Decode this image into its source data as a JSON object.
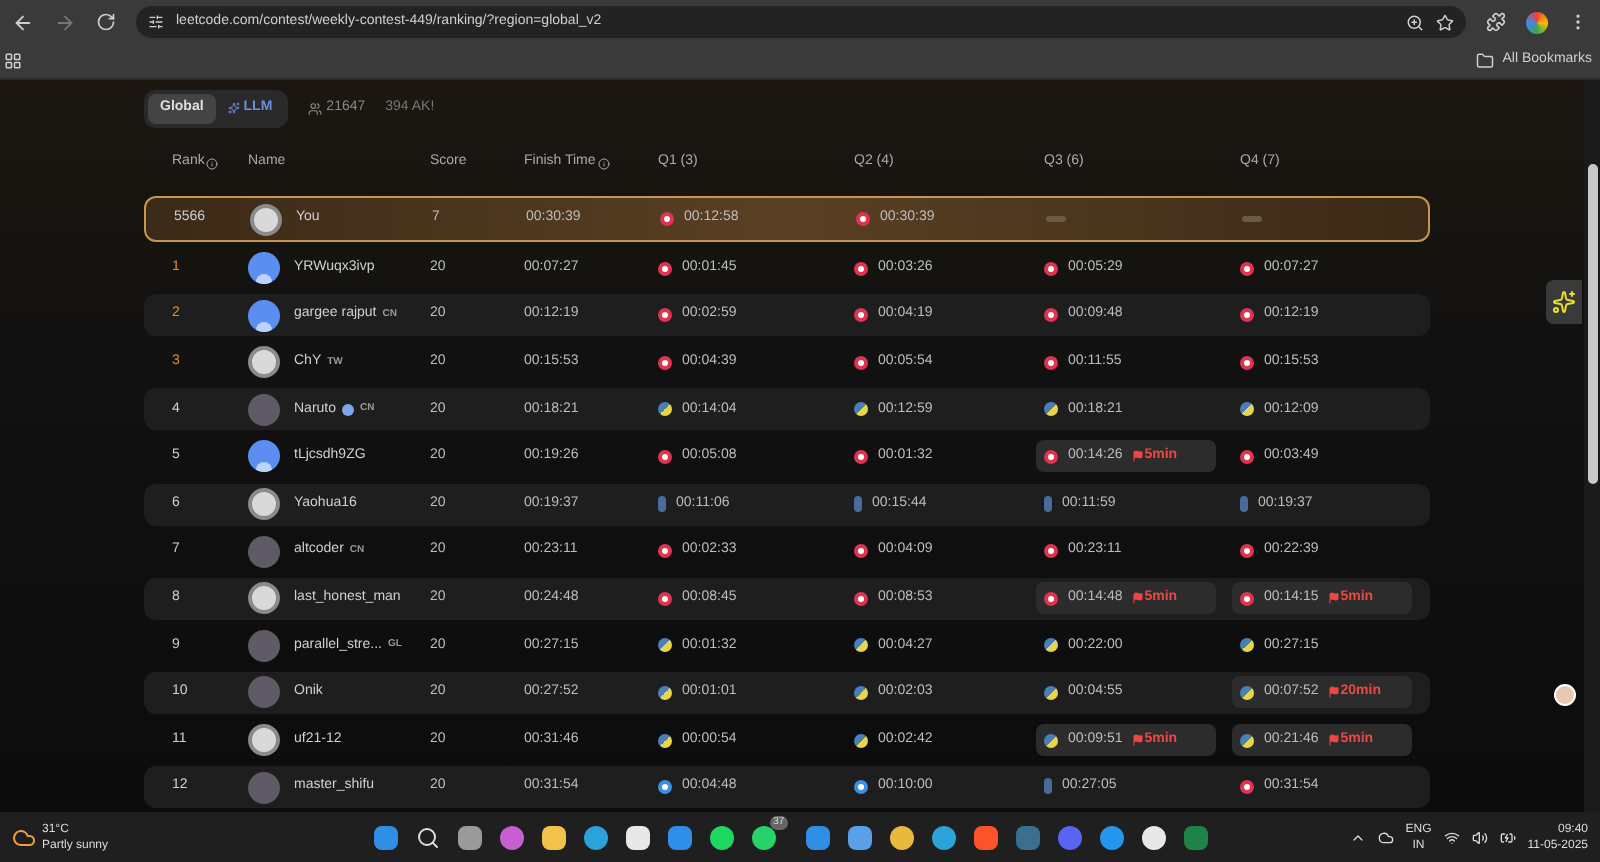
{
  "browser": {
    "url": "leetcode.com/contest/weekly-contest-449/ranking/?region=global_v2",
    "bookmarks_label": "All Bookmarks"
  },
  "toolbar": {
    "tabs": [
      {
        "label": "Global",
        "selected": true
      },
      {
        "label": "LLM",
        "selected": false
      }
    ],
    "participants": "21647",
    "ak": "394 AK!"
  },
  "table": {
    "columns": [
      "Rank",
      "Name",
      "Score",
      "Finish Time",
      "Q1 (3)",
      "Q2 (4)",
      "Q3 (6)",
      "Q4 (7)"
    ],
    "my_row": {
      "rank": "5566",
      "name": "You",
      "avatar": {
        "kind": "blank"
      },
      "score": "7",
      "finish": "00:30:39",
      "cells": [
        {
          "kind": "cpp",
          "time": "00:12:58"
        },
        {
          "kind": "cpp",
          "time": "00:30:39"
        },
        {
          "kind": "none"
        },
        {
          "kind": "none"
        }
      ]
    },
    "rows": [
      {
        "rank": "1",
        "medal": true,
        "name": "YRWuqx3ivp",
        "avatar": {
          "kind": "default"
        },
        "score": "20",
        "finish": "00:07:27",
        "cells": [
          {
            "kind": "cpp",
            "time": "00:01:45"
          },
          {
            "kind": "cpp",
            "time": "00:03:26"
          },
          {
            "kind": "cpp",
            "time": "00:05:29"
          },
          {
            "kind": "cpp",
            "time": "00:07:27"
          }
        ]
      },
      {
        "rank": "2",
        "medal": true,
        "name": "gargee rajput",
        "tag": "CN",
        "avatar": {
          "kind": "default"
        },
        "score": "20",
        "finish": "00:12:19",
        "cells": [
          {
            "kind": "cpp",
            "time": "00:02:59"
          },
          {
            "kind": "cpp",
            "time": "00:04:19"
          },
          {
            "kind": "cpp",
            "time": "00:09:48"
          },
          {
            "kind": "cpp",
            "time": "00:12:19"
          }
        ]
      },
      {
        "rank": "3",
        "medal": true,
        "name": "ChY",
        "tag": "TW",
        "avatar": {
          "kind": "blank"
        },
        "score": "20",
        "finish": "00:15:53",
        "cells": [
          {
            "kind": "cpp",
            "time": "00:04:39"
          },
          {
            "kind": "cpp",
            "time": "00:05:54"
          },
          {
            "kind": "cpp",
            "time": "00:11:55"
          },
          {
            "kind": "cpp",
            "time": "00:15:53"
          }
        ]
      },
      {
        "rank": "4",
        "medal": false,
        "name": "Naruto",
        "badge": true,
        "tag": "CN",
        "avatar": {
          "kind": "image"
        },
        "score": "20",
        "finish": "00:18:21",
        "cells": [
          {
            "kind": "python",
            "time": "00:14:04"
          },
          {
            "kind": "python",
            "time": "00:12:59"
          },
          {
            "kind": "python",
            "time": "00:18:21"
          },
          {
            "kind": "python",
            "time": "00:12:09"
          }
        ]
      },
      {
        "rank": "5",
        "medal": false,
        "name": "tLjcsdh9ZG",
        "avatar": {
          "kind": "default"
        },
        "score": "20",
        "finish": "00:19:26",
        "cells": [
          {
            "kind": "cpp",
            "time": "00:05:08"
          },
          {
            "kind": "cpp",
            "time": "00:01:32"
          },
          {
            "kind": "cpp",
            "time": "00:14:26",
            "penalty": "5min"
          },
          {
            "kind": "cpp",
            "time": "00:03:49"
          }
        ]
      },
      {
        "rank": "6",
        "medal": false,
        "name": "Yaohua16",
        "avatar": {
          "kind": "blank"
        },
        "score": "20",
        "finish": "00:19:37",
        "cells": [
          {
            "kind": "java",
            "time": "00:11:06"
          },
          {
            "kind": "java",
            "time": "00:15:44"
          },
          {
            "kind": "java",
            "time": "00:11:59"
          },
          {
            "kind": "java",
            "time": "00:19:37"
          }
        ]
      },
      {
        "rank": "7",
        "medal": false,
        "name": "altcoder",
        "tag": "CN",
        "avatar": {
          "kind": "image"
        },
        "score": "20",
        "finish": "00:23:11",
        "cells": [
          {
            "kind": "cpp",
            "time": "00:02:33"
          },
          {
            "kind": "cpp",
            "time": "00:04:09"
          },
          {
            "kind": "cpp",
            "time": "00:23:11"
          },
          {
            "kind": "cpp",
            "time": "00:22:39"
          }
        ]
      },
      {
        "rank": "8",
        "medal": false,
        "name": "last_honest_man",
        "avatar": {
          "kind": "blank"
        },
        "score": "20",
        "finish": "00:24:48",
        "cells": [
          {
            "kind": "cpp",
            "time": "00:08:45"
          },
          {
            "kind": "cpp",
            "time": "00:08:53"
          },
          {
            "kind": "cpp",
            "time": "00:14:48",
            "penalty": "5min"
          },
          {
            "kind": "cpp",
            "time": "00:14:15",
            "penalty": "5min"
          }
        ]
      },
      {
        "rank": "9",
        "medal": false,
        "name": "parallel_stre...",
        "tag": "GL",
        "avatar": {
          "kind": "image"
        },
        "score": "20",
        "finish": "00:27:15",
        "cells": [
          {
            "kind": "python",
            "time": "00:01:32"
          },
          {
            "kind": "python",
            "time": "00:04:27"
          },
          {
            "kind": "python",
            "time": "00:22:00"
          },
          {
            "kind": "python",
            "time": "00:27:15"
          }
        ]
      },
      {
        "rank": "10",
        "medal": false,
        "name": "Onik",
        "avatar": {
          "kind": "image"
        },
        "score": "20",
        "finish": "00:27:52",
        "cells": [
          {
            "kind": "python",
            "time": "00:01:01"
          },
          {
            "kind": "python",
            "time": "00:02:03"
          },
          {
            "kind": "python",
            "time": "00:04:55"
          },
          {
            "kind": "python",
            "time": "00:07:52",
            "penalty": "20min"
          }
        ]
      },
      {
        "rank": "11",
        "medal": false,
        "name": "uf21-12",
        "avatar": {
          "kind": "blank"
        },
        "score": "20",
        "finish": "00:31:46",
        "cells": [
          {
            "kind": "python",
            "time": "00:00:54"
          },
          {
            "kind": "python",
            "time": "00:02:42"
          },
          {
            "kind": "python",
            "time": "00:09:51",
            "penalty": "5min"
          },
          {
            "kind": "python",
            "time": "00:21:46",
            "penalty": "5min"
          }
        ]
      },
      {
        "rank": "12",
        "medal": false,
        "name": "master_shifu",
        "avatar": {
          "kind": "image"
        },
        "score": "20",
        "finish": "00:31:54",
        "cells": [
          {
            "kind": "c",
            "time": "00:04:48"
          },
          {
            "kind": "c",
            "time": "00:10:00"
          },
          {
            "kind": "java",
            "time": "00:27:05"
          },
          {
            "kind": "cpp",
            "time": "00:31:54"
          }
        ]
      }
    ]
  },
  "taskbar": {
    "temperature": "31°C",
    "weather": "Partly sunny",
    "chat_badge": "37",
    "language": "ENG",
    "region": "IN",
    "time": "09:40",
    "date": "11-05-2025"
  }
}
